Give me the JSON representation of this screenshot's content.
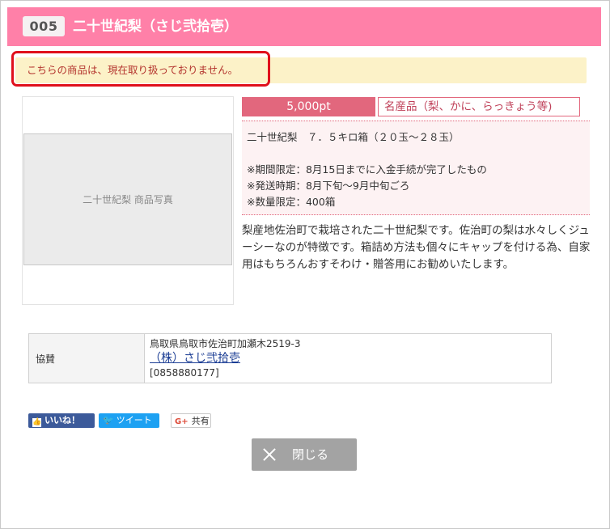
{
  "header": {
    "badge": "005",
    "title": "二十世紀梨（さじ弐拾壱）"
  },
  "notice": {
    "text": "こちらの商品は、現在取り扱っておりません。"
  },
  "product": {
    "image_alt": "二十世紀梨 商品写真",
    "price": "5,000pt",
    "category": "名産品（梨、かに、らっきょう等)",
    "spec_lines": [
      "二十世紀梨　７．５キロ箱（２０玉～２８玉）",
      "",
      "※期間限定：8月15日までに入金手続が完了したもの",
      "※発送時期：8月下旬～9月中旬ごろ",
      "※数量限定：400箱"
    ],
    "description": "梨産地佐治町で栽培された二十世紀梨です。佐治町の梨は水々しくジューシーなのが特徴です。箱詰め方法も個々にキャップを付ける為、自家用はもちろんおすそわけ・贈答用にお勧めいたします。"
  },
  "sponsor": {
    "label": "協賛",
    "address": "鳥取県鳥取市佐治町加瀬木2519-3",
    "name": "（株）さじ弐拾壱",
    "phone": "[0858880177]"
  },
  "social": {
    "facebook": "いいね！",
    "twitter": "ツイート",
    "google_mark": "G+",
    "google": "共有"
  },
  "close_button": {
    "label": "閉じる"
  }
}
